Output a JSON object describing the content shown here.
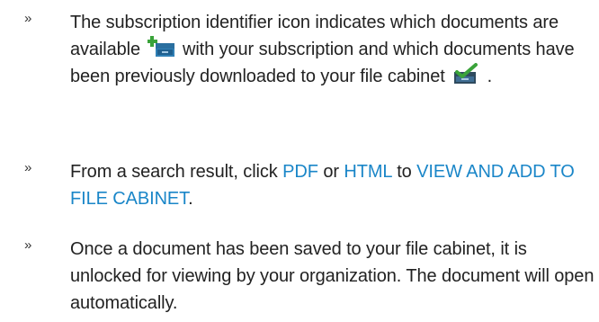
{
  "items": [
    {
      "bullet": "»",
      "text_1": "The subscription identifier icon indicates which documents are available",
      "text_2": "with your subscription and which documents have been previously downloaded to your file cabinet",
      "text_3": "."
    },
    {
      "bullet": "»",
      "text_1": "From a search result, click",
      "link_pdf": "PDF",
      "text_2": "or",
      "link_html": "HTML",
      "text_3": "to",
      "link_view": "VIEW AND ADD TO FILE CABINET",
      "text_4": "."
    },
    {
      "bullet": "»",
      "text_1": "Once a document has been saved to your file cabinet, it is unlocked for viewing by your organization. The document will open automatically."
    }
  ],
  "icons": {
    "available": "subscription-available-icon",
    "downloaded": "file-cabinet-downloaded-icon"
  },
  "colors": {
    "text": "#222222",
    "link": "#1a86c8",
    "icon_green": "#3aa33a",
    "icon_dark": "#2f4a5e",
    "icon_blue": "#2f7fb5"
  }
}
